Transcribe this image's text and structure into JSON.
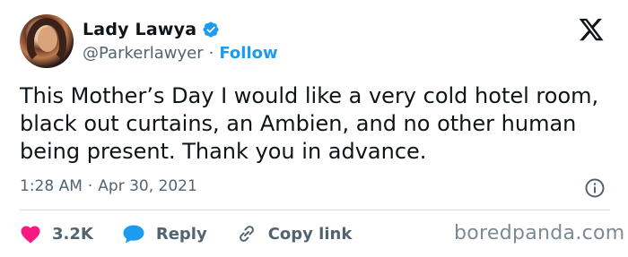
{
  "author": {
    "display_name": "Lady Lawya",
    "handle": "@Parkerlawyer",
    "separator": "·",
    "follow_label": "Follow",
    "verified": true
  },
  "brand_logo": "x-logo-icon",
  "tweet": {
    "text": "This Mother’s Day I would like a very cold hotel room, black out curtains, an Ambien, and no other human being present. Thank you in advance.",
    "time": "1:28 AM",
    "separator": "·",
    "date": "Apr 30, 2021"
  },
  "actions": {
    "likes": "3.2K",
    "reply_label": "Reply",
    "copy_link_label": "Copy link"
  },
  "watermark": "boredpanda.com",
  "colors": {
    "accent": "#1d9bf0",
    "like": "#f91880",
    "text": "#0f1419",
    "secondary": "#536471"
  }
}
